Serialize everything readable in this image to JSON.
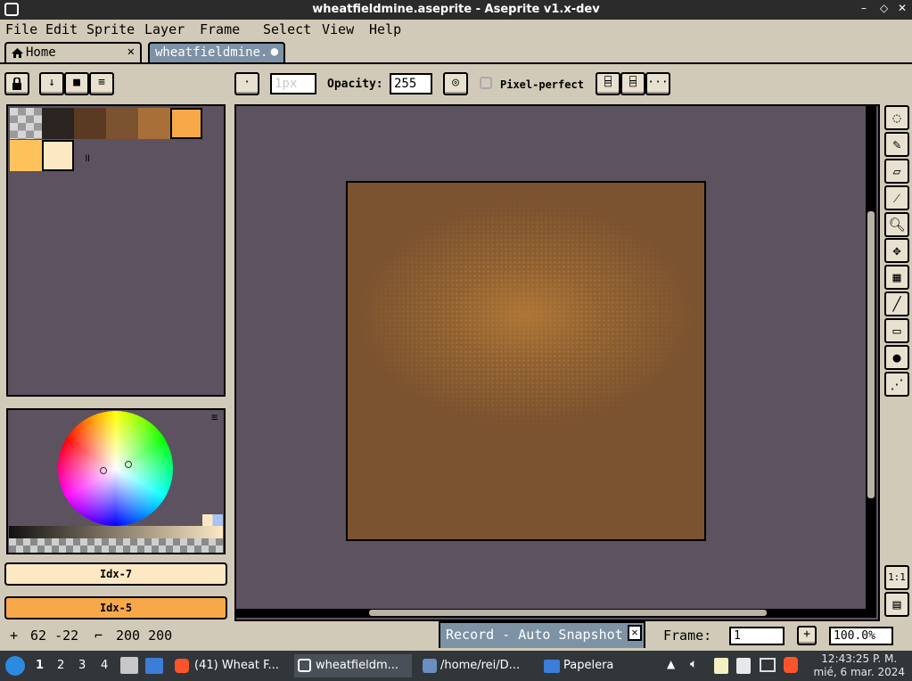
{
  "window": {
    "title": "wheatfieldmine.aseprite - Aseprite v1.x-dev"
  },
  "menu": [
    "File",
    "Edit",
    "Sprite",
    "Layer",
    "Frame",
    "Select",
    "View",
    "Help"
  ],
  "tabs": [
    {
      "label": "Home",
      "close": "✕"
    },
    {
      "label": "wheatfieldmine.",
      "close": "●"
    }
  ],
  "toolbar": {
    "brush_size_placeholder": "1px",
    "opacity_label": "Opacity:",
    "opacity_value": "255",
    "pixel_perfect_label": "Pixel-perfect",
    "more_label": "···"
  },
  "palette": {
    "colors": [
      "#2b2420",
      "#5a3a22",
      "#7b5330",
      "#a87038",
      "#f7a94a",
      "#fdc35a",
      "#fde8c4"
    ],
    "resize_handle": "॥"
  },
  "colors": {
    "foreground_label": "Idx-7",
    "foreground_color": "#fde8c4",
    "background_label": "Idx-5",
    "background_color": "#f7a94a"
  },
  "status": {
    "cursor_pos": "62 -22",
    "sprite_size": "200 200",
    "record_label": "Record - Auto Snapshot",
    "frame_label": "Frame:",
    "frame_value": "1",
    "zoom_value": "100.0%"
  },
  "taskbar": {
    "workspaces": [
      "1",
      "2",
      "3",
      "4"
    ],
    "tasks": [
      "(41) Wheat F...",
      "wheatfieldm...",
      "/home/rei/D...",
      "Papelera"
    ],
    "time": "12:43:25 P. M.",
    "date": "mié, 6 mar. 2024"
  },
  "icons": [
    "lock-icon",
    "down-arrow-icon",
    "square-icon",
    "menu-icon",
    "marquee-icon",
    "pencil-icon",
    "eraser-icon",
    "eyedropper-icon",
    "zoom-icon",
    "move-icon",
    "gradient-icon",
    "line-icon",
    "rectangle-icon",
    "fill-icon",
    "blur-icon",
    "one-to-one-icon",
    "timeline-icon"
  ]
}
